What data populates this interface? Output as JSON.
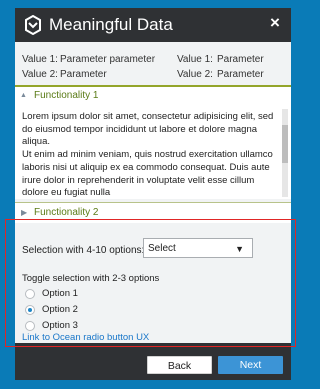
{
  "window": {
    "title": "Meaningful Data",
    "logo_icon": "brand-logo-icon",
    "close_label": "×"
  },
  "params": [
    {
      "label": "Value 1:",
      "value": "Parameter parameter",
      "label2": "Value 1:",
      "value2": "Parameter"
    },
    {
      "label": "Value 2:",
      "value": "Parameter",
      "label2": "Value 2:",
      "value2": "Parameter"
    }
  ],
  "accordion1": {
    "arrow": "▲",
    "label": "Functionality 1",
    "body": "Lorem ipsum dolor sit amet, consectetur adipisicing elit, sed do eiusmod tempor incididunt ut labore et dolore magna aliqua.\nUt enim ad minim veniam, quis nostrud exercitation ullamco laboris nisi ut aliquip ex ea commodo consequat. Duis aute irure dolor in reprehenderit in voluptate velit esse cillum dolore eu fugiat nulla"
  },
  "accordion2": {
    "arrow": "▶",
    "label": "Functionality 2"
  },
  "selection": {
    "label": "Selection with 4-10 options:",
    "selected": "Select",
    "caret": "▼"
  },
  "toggle": {
    "label": "Toggle selection with 2-3 options",
    "options": [
      "Option 1",
      "Option 2",
      "Option 3"
    ],
    "selected_index": 1
  },
  "link": "Link to Ocean radio button UX",
  "footer": {
    "back_label": "Back",
    "next_label": "Next"
  },
  "colors": {
    "page_bg": "#0a7bb7",
    "dialog_dark": "#2f3134",
    "accent_green": "#94a52a",
    "primary_button": "#3c94d6",
    "highlight_red": "#e02626"
  }
}
